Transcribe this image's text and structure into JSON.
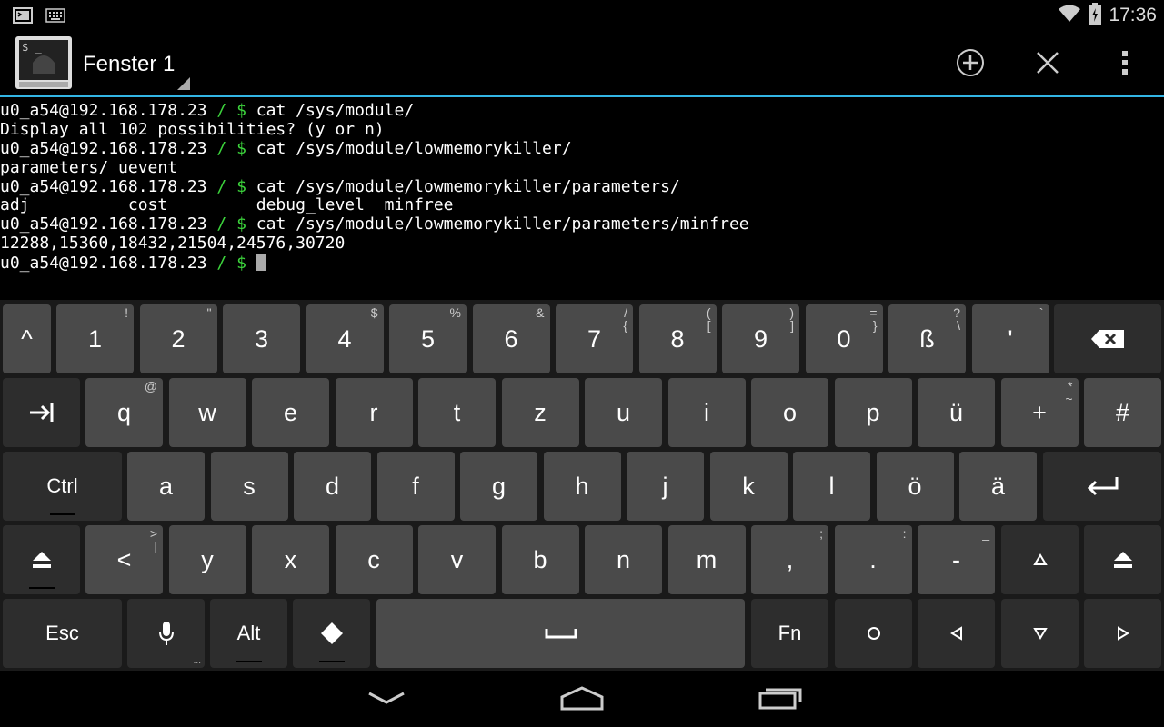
{
  "status_bar": {
    "time": "17:36"
  },
  "window": {
    "title": "Fenster 1"
  },
  "terminal": {
    "lines": [
      {
        "prompt": "u0_a54@192.168.178.23",
        "sep": " / $ ",
        "cmd": "cat /sys/module/"
      },
      {
        "text": "Display all 102 possibilities? (y or n)"
      },
      {
        "prompt": "u0_a54@192.168.178.23",
        "sep": " / $ ",
        "cmd": "cat /sys/module/lowmemorykiller/"
      },
      {
        "text": "parameters/ uevent"
      },
      {
        "prompt": "u0_a54@192.168.178.23",
        "sep": " / $ ",
        "cmd": "cat /sys/module/lowmemorykiller/parameters/"
      },
      {
        "text": "adj          cost         debug_level  minfree"
      },
      {
        "prompt": "u0_a54@192.168.178.23",
        "sep": " / $ ",
        "cmd": "cat /sys/module/lowmemorykiller/parameters/minfree"
      },
      {
        "text": "12288,15360,18432,21504,24576,30720"
      },
      {
        "prompt": "u0_a54@192.168.178.23",
        "sep": " / $ ",
        "cmd": ""
      }
    ]
  },
  "keyboard": {
    "row1": [
      {
        "label": "^",
        "hint": ""
      },
      {
        "label": "1",
        "hint": "!"
      },
      {
        "label": "2",
        "hint": "\""
      },
      {
        "label": "3",
        "hint": ""
      },
      {
        "label": "4",
        "hint": "$"
      },
      {
        "label": "5",
        "hint": "%"
      },
      {
        "label": "6",
        "hint": "&"
      },
      {
        "label": "7",
        "hint": "/",
        "hint2": "{"
      },
      {
        "label": "8",
        "hint": "(",
        "hint2": "["
      },
      {
        "label": "9",
        "hint": ")",
        "hint2": "]"
      },
      {
        "label": "0",
        "hint": "=",
        "hint2": "}"
      },
      {
        "label": "ß",
        "hint": "?",
        "hint2": "\\"
      },
      {
        "label": "'",
        "hint": "`"
      }
    ],
    "row2": [
      {
        "label": "q",
        "hint": "@"
      },
      {
        "label": "w",
        "hint": ""
      },
      {
        "label": "e",
        "hint": ""
      },
      {
        "label": "r",
        "hint": ""
      },
      {
        "label": "t",
        "hint": ""
      },
      {
        "label": "z",
        "hint": ""
      },
      {
        "label": "u",
        "hint": ""
      },
      {
        "label": "i",
        "hint": ""
      },
      {
        "label": "o",
        "hint": ""
      },
      {
        "label": "p",
        "hint": ""
      },
      {
        "label": "ü",
        "hint": ""
      },
      {
        "label": "+",
        "hint": "*",
        "hint2": "~"
      },
      {
        "label": "#",
        "hint": ""
      }
    ],
    "row3": [
      {
        "label": "a"
      },
      {
        "label": "s"
      },
      {
        "label": "d"
      },
      {
        "label": "f"
      },
      {
        "label": "g"
      },
      {
        "label": "h"
      },
      {
        "label": "j"
      },
      {
        "label": "k"
      },
      {
        "label": "l"
      },
      {
        "label": "ö"
      },
      {
        "label": "ä"
      }
    ],
    "row4": [
      {
        "label": "<",
        "hint": ">",
        "hint2": "|"
      },
      {
        "label": "y",
        "hint": ""
      },
      {
        "label": "x",
        "hint": ""
      },
      {
        "label": "c",
        "hint": ""
      },
      {
        "label": "v",
        "hint": ""
      },
      {
        "label": "b",
        "hint": ""
      },
      {
        "label": "n",
        "hint": ""
      },
      {
        "label": "m",
        "hint": ""
      },
      {
        "label": ",",
        "hint": ";"
      },
      {
        "label": ".",
        "hint": ":"
      },
      {
        "label": "-",
        "hint": "_"
      }
    ],
    "ctrl_label": "Ctrl",
    "esc_label": "Esc",
    "alt_label": "Alt",
    "fn_label": "Fn"
  }
}
